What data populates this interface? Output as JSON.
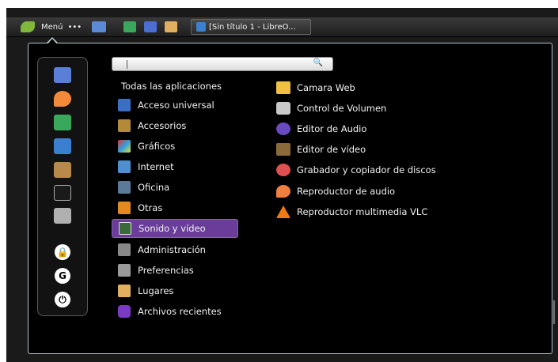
{
  "panel": {
    "menu_label": "Menú",
    "dots": "•••",
    "task_title": "[Sin título 1 - LibreO...",
    "colors": {
      "menu_icon": "#7fb83a"
    }
  },
  "search": {
    "placeholder": "",
    "value": "",
    "icon": "magnifier-icon"
  },
  "sidebar": {
    "heading": "Todas las aplicaciones",
    "categories": [
      {
        "label": "Acceso universal",
        "icon": "accessibility-icon",
        "color": "#3a6fc4"
      },
      {
        "label": "Accesorios",
        "icon": "accessories-icon",
        "color": "#b38a3a"
      },
      {
        "label": "Gráficos",
        "icon": "graphics-icon",
        "color": "#c0407a"
      },
      {
        "label": "Internet",
        "icon": "internet-icon",
        "color": "#4f8fd0"
      },
      {
        "label": "Oficina",
        "icon": "office-icon",
        "color": "#5a7a9a"
      },
      {
        "label": "Otras",
        "icon": "other-icon",
        "color": "#e08a20"
      },
      {
        "label": "Sonido y vídeo",
        "icon": "multimedia-icon",
        "color": "#3a6a3a",
        "selected": true
      },
      {
        "label": "Administración",
        "icon": "administration-icon",
        "color": "#888888"
      },
      {
        "label": "Preferencias",
        "icon": "preferences-icon",
        "color": "#9a9a9a"
      },
      {
        "label": "Lugares",
        "icon": "folder-icon",
        "color": "#e0b060"
      },
      {
        "label": "Archivos recientes",
        "icon": "recent-files-icon",
        "color": "#7a3ac4"
      }
    ]
  },
  "apps": [
    {
      "label": "Camara Web",
      "icon": "webcam-icon",
      "color": "#f0c040"
    },
    {
      "label": "Control de Volumen",
      "icon": "volume-icon",
      "color": "#c8c8c8"
    },
    {
      "label": "Editor de Audio",
      "icon": "audio-editor-icon",
      "color": "#6a4ac0"
    },
    {
      "label": "Editor de vídeo",
      "icon": "video-editor-icon",
      "color": "#8a6a3a"
    },
    {
      "label": "Grabador y copiador de discos",
      "icon": "disc-burner-icon",
      "color": "#e05050"
    },
    {
      "label": "Reproductor de audio",
      "icon": "audio-player-icon",
      "color": "#f08040"
    },
    {
      "label": "Reproductor multimedia VLC",
      "icon": "vlc-icon",
      "color": "#f07a10"
    }
  ],
  "favorites": [
    {
      "icon": "mail-icon",
      "color": "#5b7fd6"
    },
    {
      "icon": "audio-player-icon",
      "color": "#f28a3a"
    },
    {
      "icon": "image-viewer-icon",
      "color": "#3aa85a"
    },
    {
      "icon": "writer-icon",
      "color": "#3a7fd0"
    },
    {
      "icon": "package-icon",
      "color": "#b88a4a"
    },
    {
      "icon": "terminal-icon",
      "color": "#2a2a2a"
    },
    {
      "icon": "calculator-icon",
      "color": "#b0b0b0"
    },
    {
      "icon": "lock-icon",
      "symbol": "🔒"
    },
    {
      "icon": "logout-icon",
      "symbol": "G"
    },
    {
      "icon": "power-icon",
      "symbol": "⏻"
    }
  ]
}
